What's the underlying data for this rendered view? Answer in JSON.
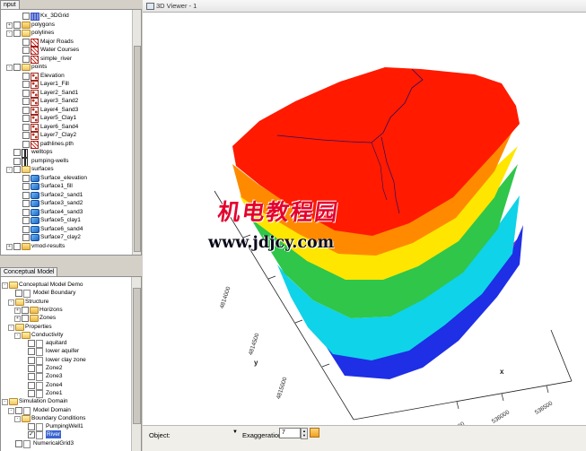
{
  "left_top_panel": {
    "tab_label": "nput",
    "tree": [
      {
        "id": "kx3dgrid",
        "label": "Kx_3DGrid",
        "icon": "grid-icon",
        "level": 1,
        "checkbox": true,
        "checked": false
      },
      {
        "id": "polygons",
        "label": "polygons",
        "icon": "folder-icon",
        "level": 0,
        "toggle": "+",
        "checkbox": true,
        "checked": false
      },
      {
        "id": "polylines",
        "label": "polylines",
        "icon": "folder-open-icon",
        "level": 0,
        "toggle": "-",
        "checkbox": true,
        "checked": false
      },
      {
        "id": "major-roads",
        "label": "Major Roads",
        "icon": "polyline-icon",
        "level": 1,
        "checkbox": true,
        "checked": false
      },
      {
        "id": "water-courses",
        "label": "Water Courses",
        "icon": "polyline-icon",
        "level": 1,
        "checkbox": true,
        "checked": false
      },
      {
        "id": "simple-river",
        "label": "simple_river",
        "icon": "polyline-icon",
        "level": 1,
        "checkbox": true,
        "checked": false
      },
      {
        "id": "points",
        "label": "points",
        "icon": "folder-open-icon",
        "level": 0,
        "toggle": "-",
        "checkbox": true,
        "checked": false
      },
      {
        "id": "elevation",
        "label": "Elevation",
        "icon": "points-icon",
        "level": 1,
        "checkbox": true,
        "checked": false
      },
      {
        "id": "layer1-fill",
        "label": "Layer1_Fill",
        "icon": "points-icon",
        "level": 1,
        "checkbox": true,
        "checked": false
      },
      {
        "id": "layer2-sand1",
        "label": "Layer2_Sand1",
        "icon": "points-icon",
        "level": 1,
        "checkbox": true,
        "checked": false
      },
      {
        "id": "layer3-sand2",
        "label": "Layer3_Sand2",
        "icon": "points-icon",
        "level": 1,
        "checkbox": true,
        "checked": false
      },
      {
        "id": "layer4-sand3",
        "label": "Layer4_Sand3",
        "icon": "points-icon",
        "level": 1,
        "checkbox": true,
        "checked": false
      },
      {
        "id": "layer5-clay1",
        "label": "Layer5_Clay1",
        "icon": "points-icon",
        "level": 1,
        "checkbox": true,
        "checked": false
      },
      {
        "id": "layer6-sand4",
        "label": "Layer6_Sand4",
        "icon": "points-icon",
        "level": 1,
        "checkbox": true,
        "checked": false
      },
      {
        "id": "layer7-clay2",
        "label": "Layer7_Clay2",
        "icon": "points-icon",
        "level": 1,
        "checkbox": true,
        "checked": false
      },
      {
        "id": "pathlines",
        "label": "pathlines.pth",
        "icon": "polyline-icon",
        "level": 1,
        "checkbox": true,
        "checked": false
      },
      {
        "id": "welltops",
        "label": "welltops",
        "icon": "well-icon",
        "level": 0,
        "checkbox": true,
        "checked": false
      },
      {
        "id": "pumping-wells",
        "label": "pumping-wells",
        "icon": "well-icon",
        "level": 0,
        "checkbox": true,
        "checked": false
      },
      {
        "id": "surfaces",
        "label": "surfaces",
        "icon": "folder-open-icon",
        "level": 0,
        "toggle": "-",
        "checkbox": true,
        "checked": false
      },
      {
        "id": "surface-elevation",
        "label": "Surface_elevation",
        "icon": "surface-icon",
        "level": 1,
        "checkbox": true,
        "checked": false
      },
      {
        "id": "surface1-fill",
        "label": "Surface1_fill",
        "icon": "surface-icon",
        "level": 1,
        "checkbox": true,
        "checked": false
      },
      {
        "id": "surface2-sand1",
        "label": "Surface2_sand1",
        "icon": "surface-icon",
        "level": 1,
        "checkbox": true,
        "checked": false
      },
      {
        "id": "surface3-sand2",
        "label": "Surface3_sand2",
        "icon": "surface-icon",
        "level": 1,
        "checkbox": true,
        "checked": false
      },
      {
        "id": "surface4-sand3",
        "label": "Surface4_sand3",
        "icon": "surface-icon",
        "level": 1,
        "checkbox": true,
        "checked": false
      },
      {
        "id": "surface5-clay1",
        "label": "Surface5_clay1",
        "icon": "surface-icon",
        "level": 1,
        "checkbox": true,
        "checked": false
      },
      {
        "id": "surface6-sand4",
        "label": "Surface6_sand4",
        "icon": "surface-icon",
        "level": 1,
        "checkbox": true,
        "checked": false
      },
      {
        "id": "surface7-clay2",
        "label": "Surface7_clay2",
        "icon": "surface-icon",
        "level": 1,
        "checkbox": true,
        "checked": false
      },
      {
        "id": "vmod-results",
        "label": "vmod-results",
        "icon": "folder-icon",
        "level": 0,
        "toggle": "+",
        "checkbox": true,
        "checked": false
      }
    ]
  },
  "left_bottom_panel": {
    "tab_label": "Conceptual Model",
    "tree": [
      {
        "id": "cm-demo",
        "label": "Conceptual Model Demo",
        "icon": "folder-open-icon",
        "level": 0,
        "toggle": "-",
        "checkbox": false
      },
      {
        "id": "model-boundary",
        "label": "Model Boundary",
        "icon": "leaf-icon",
        "level": 1,
        "checkbox": true,
        "checked": false
      },
      {
        "id": "structure",
        "label": "Structure",
        "icon": "folder-open-icon",
        "level": 1,
        "toggle": "-",
        "checkbox": false
      },
      {
        "id": "horizons",
        "label": "Horizons",
        "icon": "folder-icon",
        "level": 2,
        "toggle": "+",
        "checkbox": true,
        "checked": false
      },
      {
        "id": "zones",
        "label": "Zones",
        "icon": "folder-icon",
        "level": 2,
        "toggle": "+",
        "checkbox": true,
        "checked": false
      },
      {
        "id": "properties",
        "label": "Properties",
        "icon": "folder-open-icon",
        "level": 1,
        "toggle": "-",
        "checkbox": false
      },
      {
        "id": "conductivity",
        "label": "Conductivity",
        "icon": "folder-open-icon",
        "level": 2,
        "toggle": "-",
        "checkbox": false
      },
      {
        "id": "aquitard",
        "label": "aquitard",
        "icon": "leaf-icon",
        "level": 3,
        "checkbox": true,
        "checked": false
      },
      {
        "id": "lower-aquifer",
        "label": "lower aquifer",
        "icon": "leaf-icon",
        "level": 3,
        "checkbox": true,
        "checked": false
      },
      {
        "id": "lower-clay-zone",
        "label": "lower clay zone",
        "icon": "leaf-icon",
        "level": 3,
        "checkbox": true,
        "checked": false
      },
      {
        "id": "zone2a",
        "label": "Zone2",
        "icon": "leaf-icon",
        "level": 3,
        "checkbox": true,
        "checked": false
      },
      {
        "id": "zone3",
        "label": "Zone3",
        "icon": "leaf-icon",
        "level": 3,
        "checkbox": true,
        "checked": false
      },
      {
        "id": "zone4",
        "label": "Zone4",
        "icon": "leaf-icon",
        "level": 3,
        "checkbox": true,
        "checked": false
      },
      {
        "id": "zone1",
        "label": "Zone1",
        "icon": "leaf-icon",
        "level": 3,
        "checkbox": true,
        "checked": false
      },
      {
        "id": "simulation-domain",
        "label": "Simulation Domain",
        "icon": "folder-open-icon",
        "level": 0,
        "toggle": "-",
        "checkbox": false
      },
      {
        "id": "model-domain",
        "label": "Model Domain",
        "icon": "leaf-icon",
        "level": 1,
        "toggle": "-",
        "checkbox": true,
        "checked": false
      },
      {
        "id": "boundary-conditions",
        "label": "Boundary Conditions",
        "icon": "folder-open-icon",
        "level": 2,
        "toggle": "-",
        "checkbox": false
      },
      {
        "id": "pumping-well1",
        "label": "PumpingWell1",
        "icon": "leaf-icon",
        "level": 3,
        "checkbox": true,
        "checked": false
      },
      {
        "id": "river",
        "label": "River",
        "icon": "leaf-icon",
        "level": 3,
        "checkbox": true,
        "checked": true,
        "selected": true
      },
      {
        "id": "numerical-grid",
        "label": "NumericalGrid3",
        "icon": "leaf-icon",
        "level": 1,
        "checkbox": true,
        "checked": false
      }
    ]
  },
  "viewer": {
    "title": "3D Viewer - 1",
    "axes": {
      "y_ticks": [
        "4815000",
        "4814500",
        "4814000"
      ],
      "y_label": "y",
      "x_ticks": [
        "535500",
        "536000",
        "536500"
      ],
      "x_label": "x"
    },
    "layer_colors": [
      "#ff1a00",
      "#ff8a00",
      "#ffe600",
      "#2fc64a",
      "#0fd3e8",
      "#1e2fe6",
      "#8a2bd6"
    ],
    "status": {
      "object_label": "Object:",
      "object_value": "",
      "exaggeration_label": "Exaggeration",
      "exaggeration_value": "7"
    }
  },
  "watermark": {
    "line1": "机电教程园",
    "line2": "www.jdjcy.com"
  }
}
